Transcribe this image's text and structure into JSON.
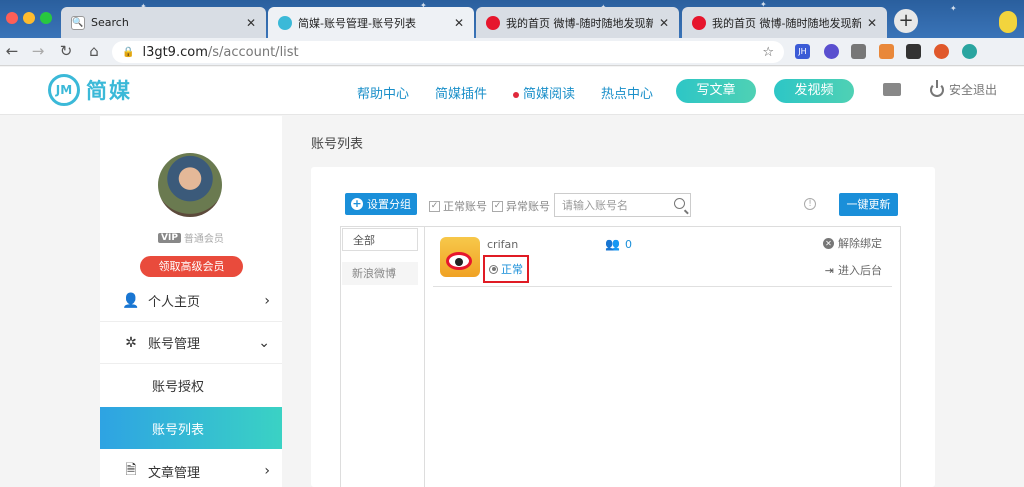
{
  "browser": {
    "tabs": [
      {
        "label": "Search",
        "favicon": "search-favicon",
        "active": false
      },
      {
        "label": "简媒-账号管理-账号列表",
        "favicon": "jianmei-favicon",
        "active": true
      },
      {
        "label": "我的首页 微博-随时随地发现新鲜",
        "favicon": "weibo-favicon",
        "active": false
      },
      {
        "label": "我的首页 微博-随时随地发现新鲜",
        "favicon": "weibo-favicon",
        "active": false
      }
    ],
    "new_tab": "+",
    "url_host": "l3gt9.com",
    "url_path": "/s/account/list",
    "extensions": [
      {
        "label": "JH",
        "color": "#3b5bd6"
      },
      {
        "label": "",
        "color": "#5a4fcf"
      },
      {
        "label": "",
        "color": "#777777"
      },
      {
        "label": "",
        "color": "#e9883a"
      },
      {
        "label": "",
        "color": "#333333"
      },
      {
        "label": "",
        "color": "#e0582b"
      },
      {
        "label": "",
        "color": "#2aa5a0"
      }
    ]
  },
  "site": {
    "logo_mark": "JM",
    "logo_text": "简媒",
    "nav": [
      "帮助中心",
      "简媒插件",
      "简媒阅读",
      "热点中心"
    ],
    "write_button": "写文章",
    "video_button": "发视频",
    "logout": "安全退出"
  },
  "sidebar": {
    "vip_badge": "VIP",
    "member_level": "普通会员",
    "upgrade_button": "领取高级会员",
    "items": [
      {
        "label": "个人主页",
        "icon": "person-icon",
        "chevron": "›"
      },
      {
        "label": "账号管理",
        "icon": "accounts-icon",
        "chevron": "⌄"
      },
      {
        "label": "账号授权"
      },
      {
        "label": "账号列表"
      },
      {
        "label": "文章管理",
        "icon": "document-icon",
        "chevron": "›"
      }
    ]
  },
  "main": {
    "page_title": "账号列表",
    "set_group_button": "设置分组",
    "filter_normal": "正常账号",
    "filter_abnormal": "异常账号",
    "search_placeholder": "请输入账号名",
    "refresh_button": "一键更新",
    "categories": [
      "全部",
      "新浪微博"
    ],
    "account": {
      "name": "crifan",
      "status": "正常",
      "fans_count": "0",
      "unbind": "解除绑定",
      "enter_backend": "进入后台"
    }
  }
}
